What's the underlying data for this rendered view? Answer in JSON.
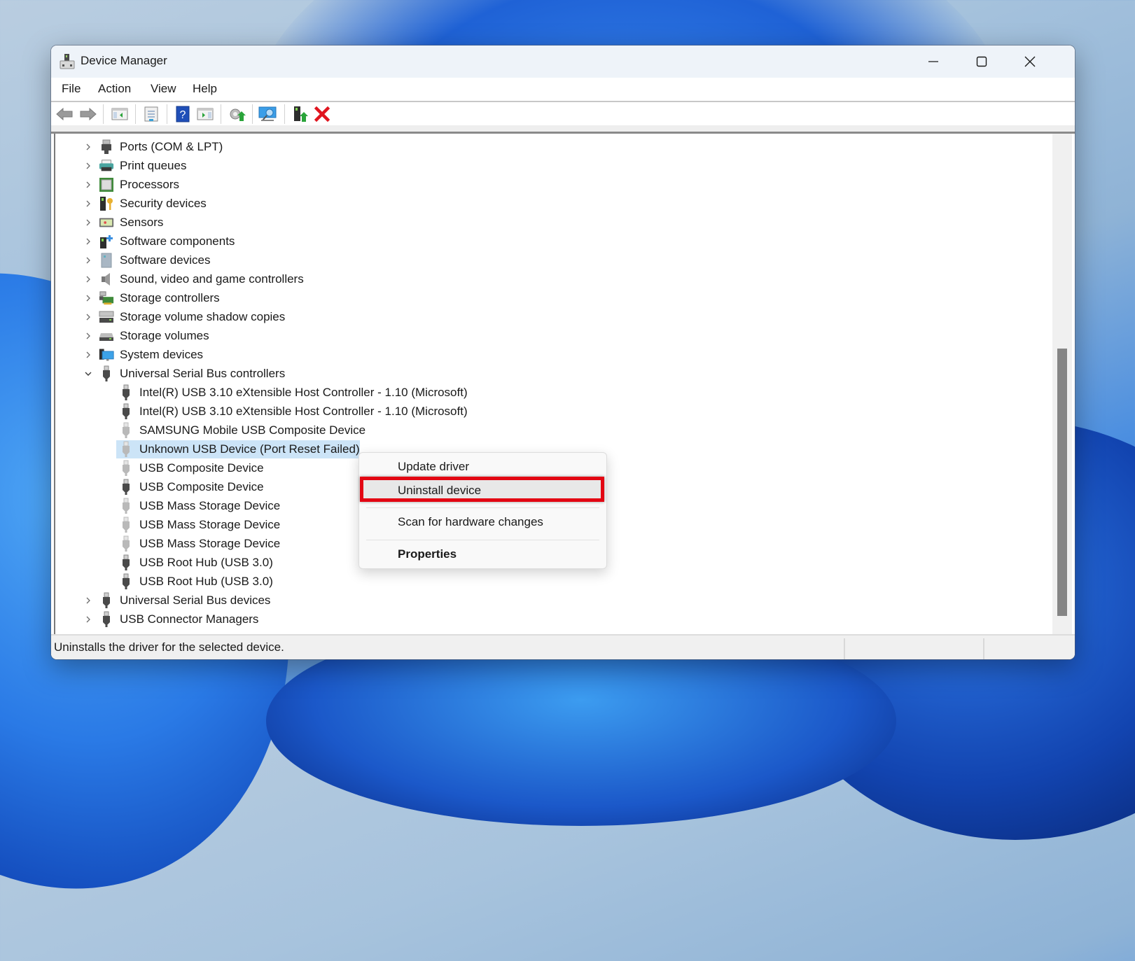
{
  "window": {
    "title": "Device Manager",
    "controls": {
      "minimize": "minimize",
      "maximize": "maximize",
      "close": "close"
    }
  },
  "menubar": {
    "items": [
      {
        "label": "File"
      },
      {
        "label": "Action"
      },
      {
        "label": "View"
      },
      {
        "label": "Help"
      }
    ]
  },
  "toolbar": {
    "buttons": [
      {
        "name": "back-arrow-icon",
        "tooltip": "Back"
      },
      {
        "name": "forward-arrow-icon",
        "tooltip": "Forward"
      },
      {
        "name": "show-hide-console-tree-icon",
        "tooltip": "Show/Hide Console Tree"
      },
      {
        "name": "properties-icon",
        "tooltip": "Properties"
      },
      {
        "name": "help-icon",
        "tooltip": "Help"
      },
      {
        "name": "show-hide-action-pane-icon",
        "tooltip": "Show/Hide Action Pane"
      },
      {
        "name": "update-driver-icon",
        "tooltip": "Update Driver"
      },
      {
        "name": "scan-hardware-icon",
        "tooltip": "Scan for hardware changes"
      },
      {
        "name": "enable-device-icon",
        "tooltip": "Enable device"
      },
      {
        "name": "uninstall-device-icon",
        "tooltip": "Uninstall device"
      }
    ]
  },
  "tree": {
    "rows": [
      {
        "label": "Ports (COM & LPT)",
        "level": 0,
        "expander": "collapsed",
        "icon": "port-icon"
      },
      {
        "label": "Print queues",
        "level": 0,
        "expander": "collapsed",
        "icon": "printer-icon"
      },
      {
        "label": "Processors",
        "level": 0,
        "expander": "collapsed",
        "icon": "processor-icon"
      },
      {
        "label": "Security devices",
        "level": 0,
        "expander": "collapsed",
        "icon": "security-key-icon"
      },
      {
        "label": "Sensors",
        "level": 0,
        "expander": "collapsed",
        "icon": "sensor-icon"
      },
      {
        "label": "Software components",
        "level": 0,
        "expander": "collapsed",
        "icon": "software-component-icon"
      },
      {
        "label": "Software devices",
        "level": 0,
        "expander": "collapsed",
        "icon": "software-device-icon"
      },
      {
        "label": "Sound, video and game controllers",
        "level": 0,
        "expander": "collapsed",
        "icon": "speaker-icon"
      },
      {
        "label": "Storage controllers",
        "level": 0,
        "expander": "collapsed",
        "icon": "storage-controller-icon"
      },
      {
        "label": "Storage volume shadow copies",
        "level": 0,
        "expander": "collapsed",
        "icon": "shadow-copy-icon"
      },
      {
        "label": "Storage volumes",
        "level": 0,
        "expander": "collapsed",
        "icon": "storage-volume-icon"
      },
      {
        "label": "System devices",
        "level": 0,
        "expander": "collapsed",
        "icon": "system-device-icon"
      },
      {
        "label": "Universal Serial Bus controllers",
        "level": 0,
        "expander": "expanded",
        "icon": "usb-plug-icon"
      },
      {
        "label": "Intel(R) USB 3.10 eXtensible Host Controller - 1.10 (Microsoft)",
        "level": 1,
        "icon": "usb-plug-icon"
      },
      {
        "label": "Intel(R) USB 3.10 eXtensible Host Controller - 1.10 (Microsoft)",
        "level": 1,
        "icon": "usb-plug-icon"
      },
      {
        "label": "SAMSUNG Mobile USB Composite Device",
        "level": 1,
        "icon": "usb-plug-gray-icon"
      },
      {
        "label": "Unknown USB Device (Port Reset Failed)",
        "level": 1,
        "icon": "usb-plug-gray-icon",
        "selected": true
      },
      {
        "label": "USB Composite Device",
        "level": 1,
        "icon": "usb-plug-gray-icon"
      },
      {
        "label": "USB Composite Device",
        "level": 1,
        "icon": "usb-plug-icon"
      },
      {
        "label": "USB Mass Storage Device",
        "level": 1,
        "icon": "usb-plug-gray-icon"
      },
      {
        "label": "USB Mass Storage Device",
        "level": 1,
        "icon": "usb-plug-gray-icon"
      },
      {
        "label": "USB Mass Storage Device",
        "level": 1,
        "icon": "usb-plug-gray-icon"
      },
      {
        "label": "USB Root Hub (USB 3.0)",
        "level": 1,
        "icon": "usb-plug-icon"
      },
      {
        "label": "USB Root Hub (USB 3.0)",
        "level": 1,
        "icon": "usb-plug-icon"
      },
      {
        "label": "Universal Serial Bus devices",
        "level": 0,
        "expander": "collapsed",
        "icon": "usb-plug-icon"
      },
      {
        "label": "USB Connector Managers",
        "level": 0,
        "expander": "collapsed",
        "icon": "usb-plug-icon"
      }
    ]
  },
  "context_menu": {
    "items": [
      {
        "label": "Update driver"
      },
      {
        "label": "Uninstall device",
        "highlighted": true
      },
      {
        "label": "Scan for hardware changes"
      },
      {
        "label": "Properties",
        "bold": true
      }
    ]
  },
  "statusbar": {
    "text": "Uninstalls the driver for the selected device."
  },
  "colors": {
    "selection": "#cce4f7",
    "highlight_box": "#e30613",
    "uninstall_x": "#e0151f",
    "titlebar": "#eef3f9"
  }
}
